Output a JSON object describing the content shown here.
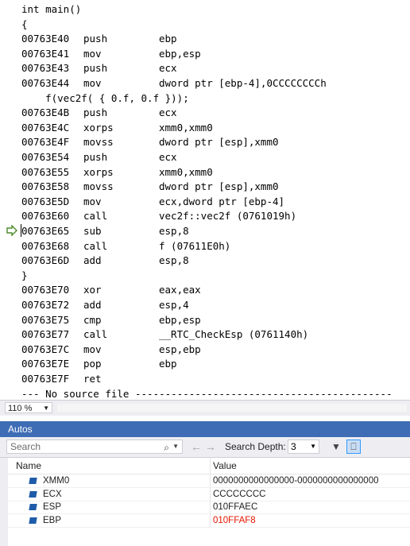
{
  "code": {
    "lines": [
      {
        "kind": "src",
        "text": "int main()"
      },
      {
        "kind": "src",
        "text": "{"
      },
      {
        "kind": "asm",
        "addr": "00763E40",
        "mn": "push",
        "op": "ebp"
      },
      {
        "kind": "asm",
        "addr": "00763E41",
        "mn": "mov",
        "op": "ebp,esp"
      },
      {
        "kind": "asm",
        "addr": "00763E43",
        "mn": "push",
        "op": "ecx"
      },
      {
        "kind": "asm",
        "addr": "00763E44",
        "mn": "mov",
        "op": "dword ptr [ebp-4],0CCCCCCCCh"
      },
      {
        "kind": "src",
        "text": "    f(vec2f( { 0.f, 0.f }));"
      },
      {
        "kind": "asm",
        "addr": "00763E4B",
        "mn": "push",
        "op": "ecx"
      },
      {
        "kind": "asm",
        "addr": "00763E4C",
        "mn": "xorps",
        "op": "xmm0,xmm0"
      },
      {
        "kind": "asm",
        "addr": "00763E4F",
        "mn": "movss",
        "op": "dword ptr [esp],xmm0"
      },
      {
        "kind": "asm",
        "addr": "00763E54",
        "mn": "push",
        "op": "ecx"
      },
      {
        "kind": "asm",
        "addr": "00763E55",
        "mn": "xorps",
        "op": "xmm0,xmm0"
      },
      {
        "kind": "asm",
        "addr": "00763E58",
        "mn": "movss",
        "op": "dword ptr [esp],xmm0"
      },
      {
        "kind": "asm",
        "addr": "00763E5D",
        "mn": "mov",
        "op": "ecx,dword ptr [ebp-4]"
      },
      {
        "kind": "asm",
        "addr": "00763E60",
        "mn": "call",
        "op": "vec2f::vec2f (0761019h)"
      },
      {
        "kind": "asm",
        "addr": "00763E65",
        "mn": "sub",
        "op": "esp,8",
        "current": true
      },
      {
        "kind": "asm",
        "addr": "00763E68",
        "mn": "call",
        "op": "f (07611E0h)"
      },
      {
        "kind": "asm",
        "addr": "00763E6D",
        "mn": "add",
        "op": "esp,8"
      },
      {
        "kind": "src",
        "text": "}"
      },
      {
        "kind": "asm",
        "addr": "00763E70",
        "mn": "xor",
        "op": "eax,eax"
      },
      {
        "kind": "asm",
        "addr": "00763E72",
        "mn": "add",
        "op": "esp,4"
      },
      {
        "kind": "asm",
        "addr": "00763E75",
        "mn": "cmp",
        "op": "ebp,esp"
      },
      {
        "kind": "asm",
        "addr": "00763E77",
        "mn": "call",
        "op": "__RTC_CheckEsp (0761140h)"
      },
      {
        "kind": "asm",
        "addr": "00763E7C",
        "mn": "mov",
        "op": "esp,ebp"
      },
      {
        "kind": "asm",
        "addr": "00763E7E",
        "mn": "pop",
        "op": "ebp"
      },
      {
        "kind": "asm",
        "addr": "00763E7F",
        "mn": "ret",
        "op": ""
      },
      {
        "kind": "src",
        "text": "--- No source file -------------------------------------------"
      }
    ]
  },
  "zoom": {
    "value": "110 %"
  },
  "autos": {
    "title": "Autos",
    "search_placeholder": "Search",
    "search_depth_label": "Search Depth:",
    "search_depth_value": "3",
    "columns": {
      "name": "Name",
      "value": "Value"
    },
    "rows": [
      {
        "name": "XMM0",
        "value": "0000000000000000-0000000000000000",
        "changed": false
      },
      {
        "name": "ECX",
        "value": "CCCCCCCC",
        "changed": false
      },
      {
        "name": "ESP",
        "value": "010FFAEC",
        "changed": false
      },
      {
        "name": "EBP",
        "value": "010FFAF8",
        "changed": true
      }
    ]
  },
  "icons": {
    "instruction_pointer": "current-instruction-arrow-icon",
    "search": "search-icon",
    "back": "back-arrow-icon",
    "forward": "forward-arrow-icon",
    "filter": "filter-icon",
    "hex": "hex-display-icon",
    "variable": "variable-icon"
  },
  "colors": {
    "changed_value": "#e51400",
    "tool_title": "#3e6db5"
  }
}
